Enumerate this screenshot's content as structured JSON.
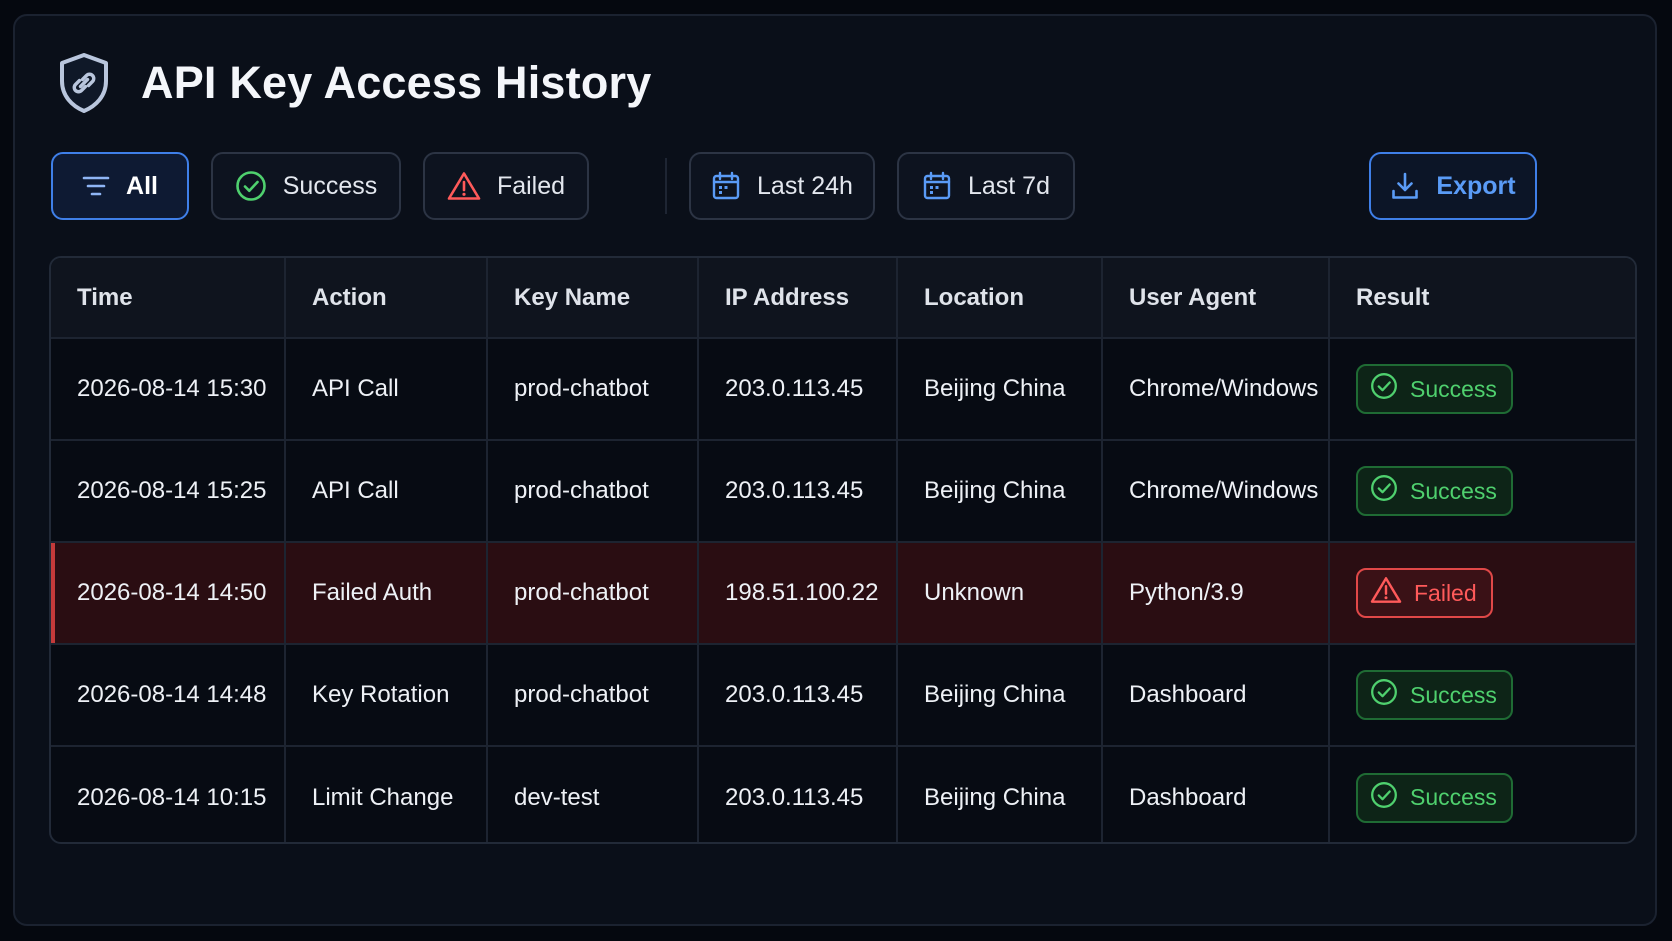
{
  "title": "API Key Access History",
  "toolbar": {
    "all_label": "All",
    "success_label": "Success",
    "failed_label": "Failed",
    "last24_label": "Last 24h",
    "last7_label": "Last 7d",
    "export_label": "Export"
  },
  "icons": {
    "header": "shield-key-icon",
    "all": "filter-lines-icon",
    "success": "check-circle-icon",
    "failed": "warning-triangle-icon",
    "date": "calendar-icon",
    "export": "download-icon"
  },
  "colors": {
    "accent": "#3f7fe8",
    "success": "#4fd06e",
    "failed": "#ff5a5a",
    "failed_row_bg": "#2a0d12"
  },
  "table": {
    "headers": {
      "time": "Time",
      "action": "Action",
      "key_name": "Key Name",
      "ip": "IP Address",
      "location": "Location",
      "user_agent": "User Agent",
      "result": "Result"
    },
    "rows": [
      {
        "time": "2026-08-14 15:30",
        "action": "API Call",
        "key_name": "prod-chatbot",
        "ip": "203.0.113.45",
        "location": "Beijing China",
        "user_agent": "Chrome/Windows",
        "result": "Success"
      },
      {
        "time": "2026-08-14 15:25",
        "action": "API Call",
        "key_name": "prod-chatbot",
        "ip": "203.0.113.45",
        "location": "Beijing China",
        "user_agent": "Chrome/Windows",
        "result": "Success"
      },
      {
        "time": "2026-08-14 14:50",
        "action": "Failed Auth",
        "key_name": "prod-chatbot",
        "ip": "198.51.100.22",
        "location": "Unknown",
        "user_agent": "Python/3.9",
        "result": "Failed"
      },
      {
        "time": "2026-08-14 14:48",
        "action": "Key Rotation",
        "key_name": "prod-chatbot",
        "ip": "203.0.113.45",
        "location": "Beijing China",
        "user_agent": "Dashboard",
        "result": "Success"
      },
      {
        "time": "2026-08-14 10:15",
        "action": "Limit Change",
        "key_name": "dev-test",
        "ip": "203.0.113.45",
        "location": "Beijing China",
        "user_agent": "Dashboard",
        "result": "Success"
      }
    ]
  }
}
